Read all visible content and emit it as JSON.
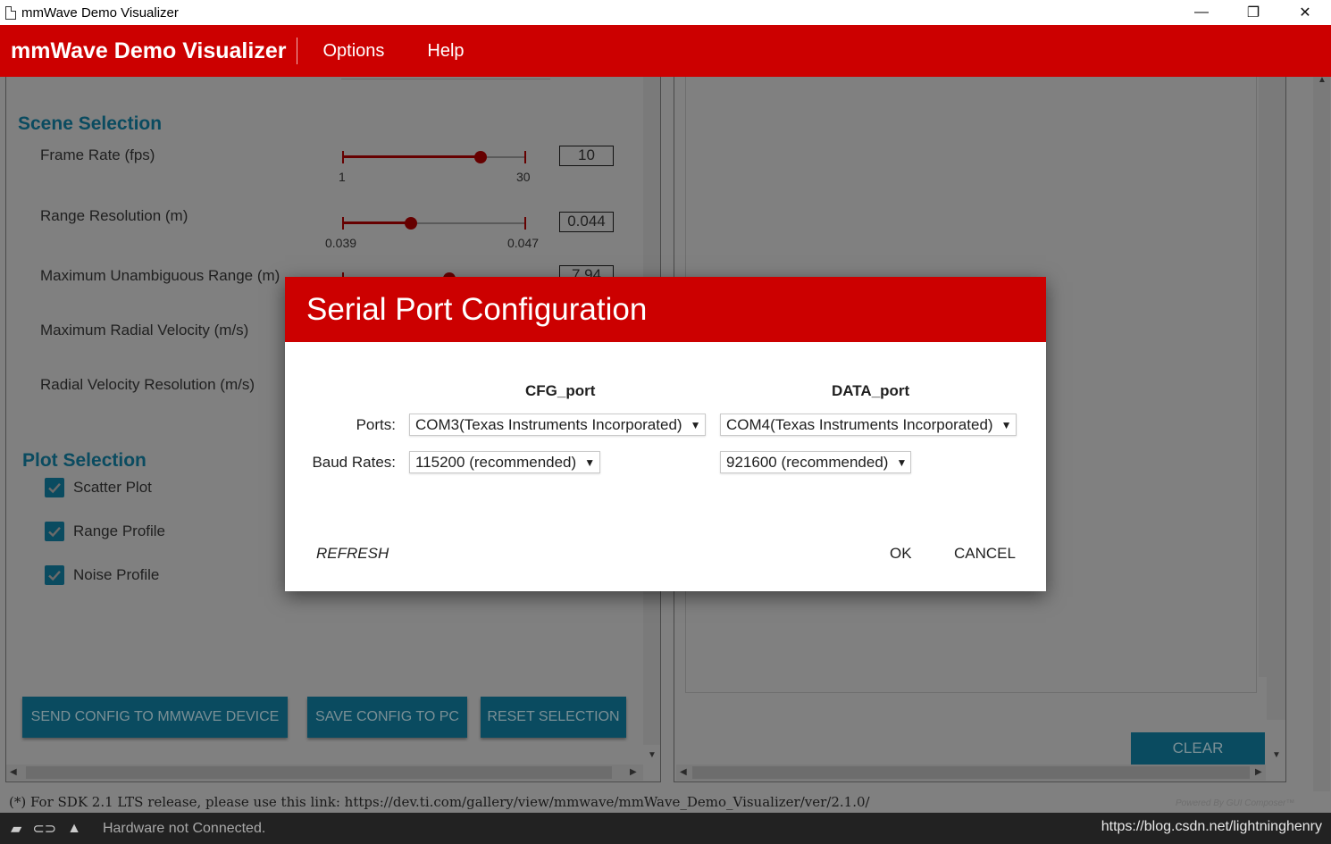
{
  "window": {
    "title": "mmWave Demo Visualizer",
    "controls": {
      "minimize": "—",
      "restore": "❐",
      "close": "✕"
    }
  },
  "appbar": {
    "title": "mmWave Demo Visualizer",
    "menu": [
      "Options",
      "Help"
    ]
  },
  "scene": {
    "title": "Scene Selection",
    "params": [
      {
        "label": "Frame Rate (fps)",
        "value": "10",
        "min_label": "1",
        "max_label": "30",
        "level": 0.75
      },
      {
        "label": "Range Resolution (m)",
        "value": "0.044",
        "min_label": "0.039",
        "max_label": "0.047",
        "level": 0.375
      },
      {
        "label": "Maximum Unambiguous Range (m)",
        "value": "7.94"
      },
      {
        "label": "Maximum Radial Velocity (m/s)"
      },
      {
        "label": "Radial Velocity Resolution (m/s)"
      }
    ]
  },
  "plot": {
    "title": "Plot Selection",
    "items": [
      {
        "label": "Scatter Plot",
        "checked": true
      },
      {
        "label": "Range Profile",
        "checked": true
      },
      {
        "label": "Noise Profile",
        "checked": true
      }
    ]
  },
  "actions": {
    "send": "SEND CONFIG TO MMWAVE DEVICE",
    "save": "SAVE CONFIG TO PC",
    "reset": "RESET SELECTION",
    "clear": "CLEAR"
  },
  "footer": {
    "note": "(*) For SDK 2.1 LTS release, please use this link: https://dev.ti.com/gallery/view/mmwave/mmWave_Demo_Visualizer/ver/2.1.0/",
    "powered": "Powered By GUI Composer™"
  },
  "dialog": {
    "title": "Serial Port Configuration",
    "cfg_header": "CFG_port",
    "data_header": "DATA_port",
    "ports_label": "Ports:",
    "baud_label": "Baud Rates:",
    "cfg_port": "COM3(Texas Instruments Incorporated)",
    "data_port": "COM4(Texas Instruments Incorporated)",
    "cfg_baud": "115200 (recommended)",
    "data_baud": "921600 (recommended)",
    "refresh": "REFRESH",
    "ok": "OK",
    "cancel": "CANCEL"
  },
  "taskbar": {
    "status": "Hardware not Connected.",
    "url": "https://blog.csdn.net/lightninghenry"
  },
  "colors": {
    "brand_red": "#cc0000",
    "teal": "#0a4b60",
    "slider": "#660000"
  }
}
